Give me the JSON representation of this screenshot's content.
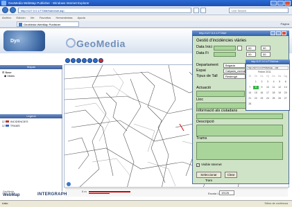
{
  "browser": {
    "title": "GeoMedia WebMap Publisher - Windows Internet Explorer",
    "url": "http://127.0.0.1/TTAM/frameset.asp",
    "search_placeholder": "Live Search",
    "menu": [
      "Archivo",
      "Edición",
      "Ver",
      "Favoritos",
      "Herramientas",
      "Ayuda"
    ],
    "tab_label": "GeoMedia WebMap Publisher",
    "command_label": "Página"
  },
  "header": {
    "brand": "GeoMedia",
    "logo_text": "Dyn"
  },
  "left_panel": {
    "mapas_title": "Mapas",
    "mapas_items": [
      "Base",
      "Vistes"
    ],
    "legend_title": "Legend",
    "legend_items": [
      {
        "label": "INCIDENCIES",
        "color": "#c0392b"
      },
      {
        "label": "TRAMS",
        "color": "#2e6bd0"
      }
    ]
  },
  "toolbar": {
    "icons": [
      {
        "name": "zoom-in-icon",
        "color": "#2d6fd2"
      },
      {
        "name": "zoom-out-icon",
        "color": "#2d6fd2"
      },
      {
        "name": "zoom-window-icon",
        "color": "#2d6fd2"
      },
      {
        "name": "pan-icon",
        "color": "#2d6fd2"
      },
      {
        "name": "fit-all-icon",
        "color": "#2d6fd2"
      },
      {
        "name": "refresh-icon",
        "color": "#2d6fd2"
      },
      {
        "name": "clear-icon",
        "color": "#d62b2b"
      }
    ]
  },
  "map": {
    "scale_value": "19126",
    "scale_label": "Escala 1:"
  },
  "footer": {
    "webmap": "WebMap",
    "webmap_sub": "GeoMedia",
    "intergraph": "INTERGRAPH"
  },
  "status": {
    "left": "Listo",
    "right": "Sitios de confianza"
  },
  "popup": {
    "window_title": "http://127.0.0.1/TTAM/",
    "form_title": "Gestió d'incidències viàries",
    "labels": {
      "data_inici": "Data Inici",
      "data_fi": "Data Fi",
      "departament": "Departament",
      "espai": "Espai",
      "tipus_tall": "Tipus de Tall",
      "actuacio": "Actuació",
      "lloc": "Lloc",
      "info": "Informació als ciutadans",
      "descripcio": "Descripció",
      "trams": "Trams",
      "visible": "Visible Internet"
    },
    "values": {
      "departament": "Brigada",
      "espai": "Calçada_vorera",
      "tipus_tall": "Restringit",
      "hora_inici": "00",
      "min_inici": "00",
      "hora_fi": "00",
      "min_fi": "00"
    },
    "buttons": {
      "select_tram": "Seleccionar Tram",
      "clear": "Clear"
    }
  },
  "calendar": {
    "window_title": "http://127.0.0.1/TTAM/cal...",
    "url": "http://127.0.0.1/TTAM/cale... sfdi",
    "month": "Febrer 2011",
    "weekdays": [
      "Dl",
      "Dt",
      "Dc",
      "Dj",
      "Dv",
      "Ds",
      "Dg"
    ],
    "days": [
      "",
      "1",
      "2",
      "3",
      "4",
      "5",
      "6",
      "7",
      "8",
      "9",
      "10",
      "11",
      "12",
      "13",
      "14",
      "15",
      "16",
      "17",
      "18",
      "19",
      "20",
      "21",
      "22",
      "23",
      "24",
      "25",
      "26",
      "27",
      "28"
    ],
    "selected": "8"
  }
}
